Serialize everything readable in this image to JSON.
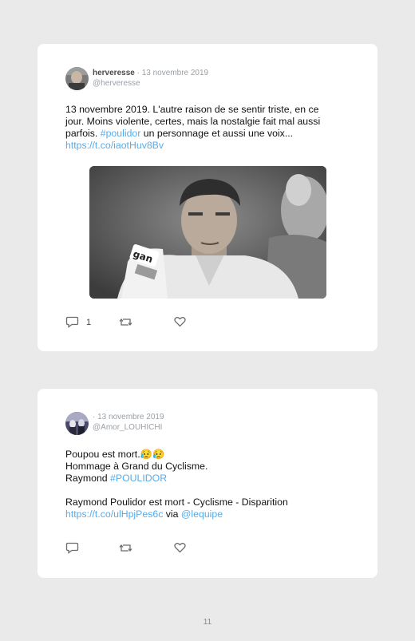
{
  "tweets": [
    {
      "author_name": "herveresse",
      "date": " · 13 novembre 2019",
      "handle": "@herveresse",
      "text_plain_1": "13 novembre 2019. L'autre raison de se sentir triste, en ce",
      "text_plain_2": "jour. Moins violente, certes, mais la nostalgie fait mal aussi",
      "text_plain_3": "parfois. ",
      "hashtag": "#poulidor",
      "text_plain_4": " un personnage et aussi une voix...",
      "link": "https://t.co/iaotHuv8Bv",
      "photo_name": "cyclist-portrait-photo",
      "reply_count": "1"
    },
    {
      "author_name": "",
      "date": "· 13 novembre 2019",
      "handle": "@Amor_LOUHICHI",
      "line1": "Poupou est mort.😥😥",
      "line2": "Hommage à Grand du Cyclisme.",
      "line3_plain": "Raymond ",
      "line3_hashtag": "#POULIDOR",
      "line4": "Raymond Poulidor est mort - Cyclisme - Disparition",
      "link": "https://t.co/ulHpjPes6c",
      "via": " via ",
      "mention": "@lequipe",
      "reply_count": ""
    }
  ],
  "page_number": "11",
  "colors": {
    "link": "#55acee",
    "card": "#ffffff",
    "background": "#eaeaea"
  }
}
